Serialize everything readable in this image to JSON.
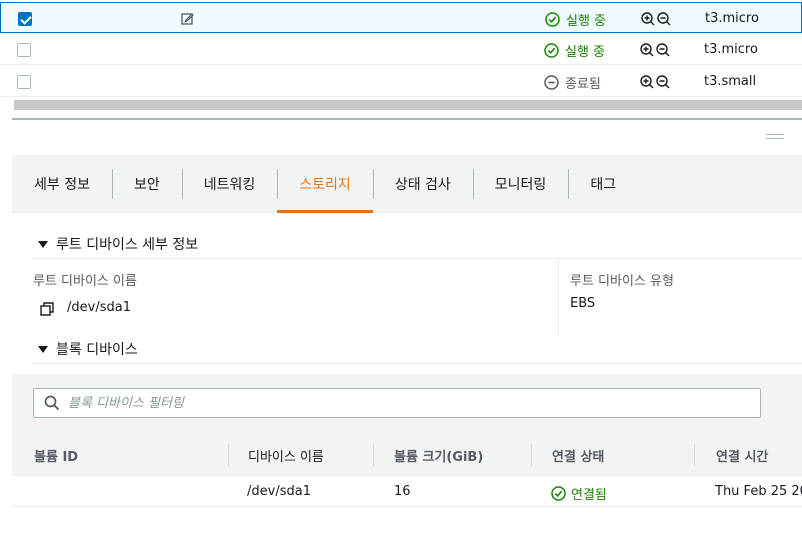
{
  "instances": [
    {
      "selected": true,
      "state": "실행 중",
      "state_kind": "running",
      "type": "t3.micro"
    },
    {
      "selected": false,
      "state": "실행 중",
      "state_kind": "running",
      "type": "t3.micro"
    },
    {
      "selected": false,
      "state": "종료됨",
      "state_kind": "terminated",
      "type": "t3.small"
    }
  ],
  "tabs": [
    "세부 정보",
    "보안",
    "네트워킹",
    "스토리지",
    "상태 검사",
    "모니터링",
    "태그"
  ],
  "active_tab": "스토리지",
  "root_device": {
    "section_title": "루트 디바이스 세부 정보",
    "name_label": "루트 디바이스 이름",
    "name_value": "/dev/sda1",
    "type_label": "루트 디바이스 유형",
    "type_value": "EBS"
  },
  "block_devices": {
    "section_title": "블록 디바이스",
    "filter_placeholder": "블록 디바이스 필터링",
    "columns": [
      "볼륨 ID",
      "디바이스 이름",
      "볼륨 크기(GiB)",
      "연결 상태",
      "연결 시간"
    ],
    "rows": [
      {
        "volume_id": "",
        "device_name": "/dev/sda1",
        "size": "16",
        "attach_status": "연결됨",
        "attach_time": "Thu Feb 25 20"
      }
    ]
  },
  "colors": {
    "accent": "#ec7211",
    "success": "#1d8102",
    "link": "#0073bb",
    "muted": "#545b64"
  },
  "icons": [
    "checkbox-checked-icon",
    "edit-icon",
    "check-circle-icon",
    "minus-circle-icon",
    "zoom-in-icon",
    "zoom-out-icon",
    "copy-icon",
    "caret-down-icon",
    "search-icon"
  ]
}
